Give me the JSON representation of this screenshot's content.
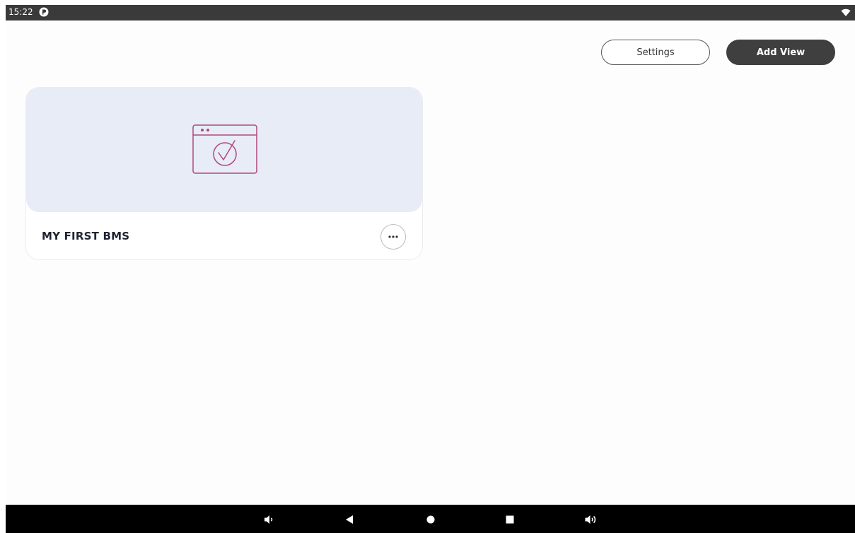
{
  "status_bar": {
    "time": "15:22",
    "left_icon": "app-notification-icon",
    "right_icon": "wifi-icon"
  },
  "toolbar": {
    "settings_label": "Settings",
    "add_view_label": "Add View"
  },
  "views": [
    {
      "title": "MY FIRST BMS",
      "thumbnail_icon": "browser-window-check-icon",
      "menu_icon": "more-horizontal-icon"
    }
  ],
  "nav_bar": {
    "items": [
      "volume-down-icon",
      "back-icon",
      "home-icon",
      "recents-icon",
      "volume-up-icon"
    ]
  },
  "colors": {
    "status_bar_bg": "#3a3a3a",
    "primary_button": "#3f3f3f",
    "card_thumbnail_bg": "#e7ecf7",
    "icon_accent": "#b0487e",
    "nav_bar_bg": "#000000"
  }
}
